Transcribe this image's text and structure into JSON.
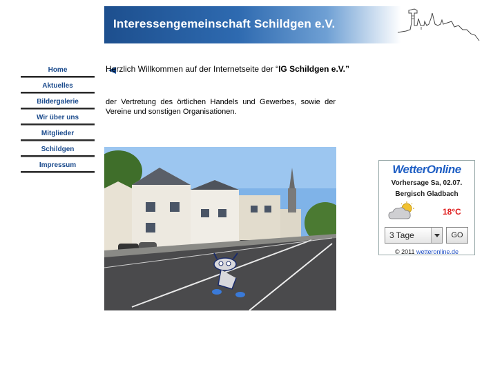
{
  "header": {
    "title": "Interessengemeinschaft Schildgen e.V.",
    "skyline_icon": "town-skyline-icon"
  },
  "nav": {
    "items": [
      {
        "label": "Home",
        "active": true
      },
      {
        "label": "Aktuelles"
      },
      {
        "label": "Bildergalerie"
      },
      {
        "label": "Wir über uns"
      },
      {
        "label": "Mitglieder"
      },
      {
        "label": "Schildgen"
      },
      {
        "label": "Impressum"
      }
    ],
    "active_indicator": "triangle-left-icon"
  },
  "main": {
    "welcome_prefix": "Herzlich Willkommen auf der Internetseite der “",
    "welcome_bold": "IG Schildgen e.V.”",
    "intro": "der Vertretung des örtlichen Handels und Gewerbes, sowie der Vereine und sonstigen Organisationen."
  },
  "weather": {
    "brand": "WetterOnline",
    "forecast": "Vorhersage Sa, 02.07.",
    "city": "Bergisch Gladbach",
    "temperature": "18°C",
    "icon": "sun-cloud-icon",
    "select_value": "3 Tage",
    "go_label": "GO",
    "copyright": "© 2011",
    "copyright_link": "wetteronline.de"
  },
  "colors": {
    "nav_text": "#1a4a8c",
    "temp": "#e02020",
    "brand": "#1f5fc4"
  }
}
